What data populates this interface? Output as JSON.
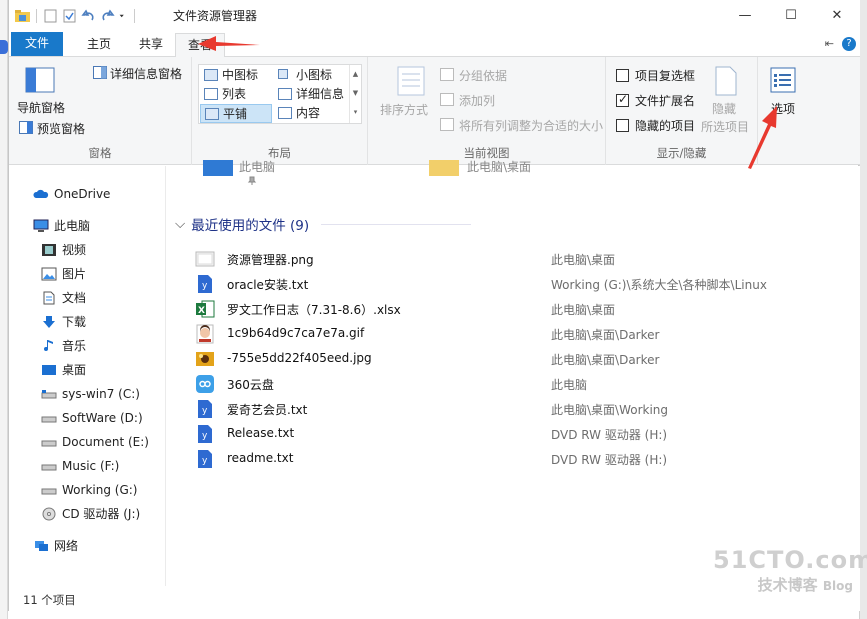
{
  "window": {
    "title": "文件资源管理器"
  },
  "tabs": [
    {
      "label": "文件"
    },
    {
      "label": "主页"
    },
    {
      "label": "共享"
    },
    {
      "label": "查看"
    }
  ],
  "ribbon": {
    "pane": {
      "nav_pane": "导航窗格",
      "preview_pane": "预览窗格",
      "details_pane": "详细信息窗格",
      "group_label": "窗格"
    },
    "layout": {
      "items": [
        "中图标",
        "小图标",
        "列表",
        "详细信息",
        "平铺",
        "内容"
      ],
      "group_label": "布局"
    },
    "current_view": {
      "sort_by": "排序方式",
      "group_by": "分组依据",
      "add_column": "添加列",
      "fit_columns": "将所有列调整为合适的大小",
      "group_label": "当前视图"
    },
    "show_hide": {
      "item_checkboxes": "项目复选框",
      "file_extensions": "文件扩展名",
      "hidden_items": "隐藏的项目",
      "hide": "隐藏",
      "hide_selected": "所选项目",
      "group_label": "显示/隐藏",
      "file_extensions_checked": true
    },
    "options": {
      "label": "选项"
    }
  },
  "nav": {
    "items": [
      {
        "label": "OneDrive",
        "icon": "cloud-icon"
      },
      {
        "label": "此电脑",
        "icon": "computer-icon"
      },
      {
        "label": "视频",
        "icon": "video-icon"
      },
      {
        "label": "图片",
        "icon": "picture-icon"
      },
      {
        "label": "文档",
        "icon": "document-icon"
      },
      {
        "label": "下载",
        "icon": "download-icon"
      },
      {
        "label": "音乐",
        "icon": "music-icon"
      },
      {
        "label": "桌面",
        "icon": "desktop-icon"
      },
      {
        "label": "sys-win7 (C:)",
        "icon": "drive-icon"
      },
      {
        "label": "SoftWare (D:)",
        "icon": "drive-icon"
      },
      {
        "label": "Document (E:)",
        "icon": "drive-icon"
      },
      {
        "label": "Music (F:)",
        "icon": "drive-icon"
      },
      {
        "label": "Working (G:)",
        "icon": "drive-icon"
      },
      {
        "label": "CD 驱动器 (J:)",
        "icon": "cd-icon"
      },
      {
        "label": "网络",
        "icon": "network-icon"
      }
    ]
  },
  "content": {
    "recent_header": "最近使用的文件 (9)",
    "files": [
      {
        "name": "资源管理器.png",
        "location": "此电脑\\桌面"
      },
      {
        "name": "oracle安装.txt",
        "location": "Working (G:)\\系统大全\\各种脚本\\Linux"
      },
      {
        "name": "罗文工作日志（7.31-8.6）.xlsx",
        "location": "此电脑\\桌面"
      },
      {
        "name": "1c9b64d9c7ca7e7a.gif",
        "location": "此电脑\\桌面\\Darker"
      },
      {
        "name": "-755e5dd22f405eed.jpg",
        "location": "此电脑\\桌面\\Darker"
      },
      {
        "name": "360云盘",
        "location": "此电脑"
      },
      {
        "name": "爱奇艺会员.txt",
        "location": "此电脑\\桌面\\Working"
      },
      {
        "name": "Release.txt",
        "location": "DVD RW 驱动器 (H:)"
      },
      {
        "name": "readme.txt",
        "location": "DVD RW 驱动器 (H:)"
      }
    ],
    "top_partial": [
      "此电脑",
      "此电脑\\桌面"
    ]
  },
  "status": {
    "count": "11 个项目"
  },
  "watermark": {
    "site": "51CTO.com",
    "sub": "技术博客",
    "blog": "Blog"
  },
  "colors": {
    "accent": "#1979ca",
    "arrow": "#e8392f",
    "header": "#1e3287"
  }
}
